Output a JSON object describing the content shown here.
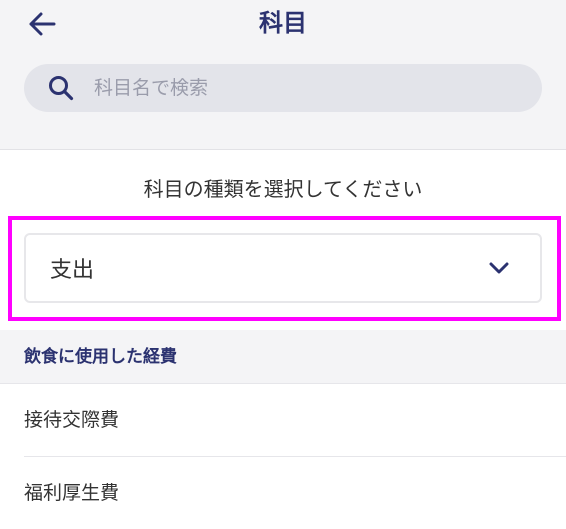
{
  "header": {
    "title": "科目",
    "back_icon": "arrow-left-icon"
  },
  "search": {
    "placeholder": "科目名で検索",
    "icon": "search-icon"
  },
  "account_type": {
    "prompt": "科目の種類を選択してください",
    "selected_value": "支出",
    "dropdown_icon": "chevron-down-icon"
  },
  "section": {
    "title": "飲食に使用した経費"
  },
  "items": [
    {
      "label": "接待交際費"
    },
    {
      "label": "福利厚生費"
    }
  ],
  "colors": {
    "accent": "#2b3270",
    "highlight": "#ff00ff",
    "background_gray": "#f4f4f6",
    "search_bg": "#e3e4ea"
  }
}
